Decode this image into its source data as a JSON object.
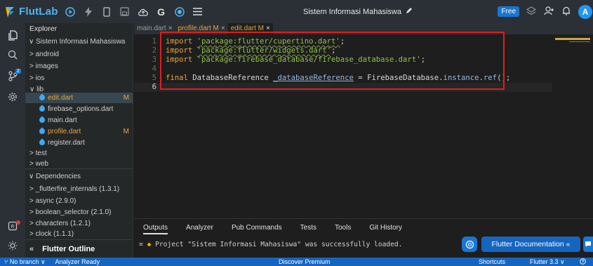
{
  "app": {
    "name": "FlutLab",
    "project_title": "Sistem Informasi Mahasiswa",
    "free_label": "Free",
    "avatar_initial": "A"
  },
  "activity_bar": {
    "git_badge": "2"
  },
  "explorer": {
    "title": "Explorer",
    "root": "Sistem Informasi Mahasiswa",
    "items": [
      {
        "label": "> android"
      },
      {
        "label": "> images"
      },
      {
        "label": "> ios"
      },
      {
        "label": "∨ lib"
      },
      {
        "label": "edit.dart",
        "flag": "M"
      },
      {
        "label": "firebase_options.dart"
      },
      {
        "label": "main.dart"
      },
      {
        "label": "profile.dart",
        "flag": "M"
      },
      {
        "label": "register.dart"
      },
      {
        "label": "> test"
      },
      {
        "label": "> web"
      }
    ],
    "dependencies_title": "Dependencies",
    "dependencies": [
      "> _flutterfire_internals (1.3.1)",
      "> async (2.9.0)",
      "> boolean_selector (2.1.0)",
      "> characters (1.2.1)",
      "> clock (1.1.1)"
    ],
    "outline_label": "Flutter Outline"
  },
  "tabs": [
    {
      "label": "main.dart",
      "close": "×"
    },
    {
      "label": "profile.dart M",
      "close": "×"
    },
    {
      "label": "edit.dart M",
      "close": "×"
    }
  ],
  "editor": {
    "line_numbers": [
      "1",
      "2",
      "3",
      "4",
      "5",
      "6"
    ],
    "import_kw": "import",
    "imports": [
      "'package:flutter/cupertino.dart'",
      "'package:flutter/widgets.dart'",
      "'package:firebase_database/firebase_database.dart'"
    ],
    "semicolon": ";",
    "final_kw": "final",
    "class_name": "DatabaseReference",
    "var_name": "_databaseReference",
    "equals": " = ",
    "rhs_class": "FirebaseDatabase.",
    "rhs_prop": "instance",
    "rhs_dot": ".",
    "rhs_fn": "ref",
    "rhs_end": "();"
  },
  "panel": {
    "tabs": [
      "Outputs",
      "Analyzer",
      "Pub Commands",
      "Tests",
      "Tools",
      "Git History"
    ],
    "console_message": "Project \"Sistem Informasi Mahasiswa\" was successfully loaded.",
    "docs_button": "Flutter Documentation «"
  },
  "status_bar": {
    "branch": "No branch ∨",
    "analyzer": "Analyzer Ready",
    "premium": "Discover Premium",
    "shortcuts": "Shortcuts",
    "flutter_version": "Flutter 3.3 ∨"
  },
  "colors": {
    "brand": "#4db6f5",
    "modified": "#e8a33a",
    "status_bar": "#1565c0",
    "highlight_box": "#e01e1e"
  }
}
